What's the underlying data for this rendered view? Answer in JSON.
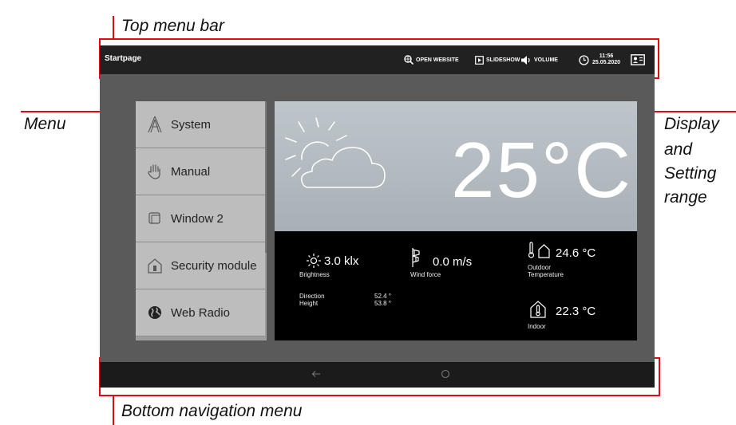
{
  "annotations": {
    "top_menu_bar": "Top menu bar",
    "menu": "Menu",
    "display_lines": [
      "Display",
      "and",
      "Setting",
      "range"
    ],
    "bottom_nav": "Bottom navigation menu"
  },
  "topbar": {
    "title": "Startpage",
    "open_website": "OPEN WEBSITE",
    "slideshow": "SLIDESHOW",
    "volume": "VOLUME",
    "time": "11:56",
    "date": "25.05.2020"
  },
  "menu": {
    "items": [
      {
        "label": "System",
        "icon": "system-icon"
      },
      {
        "label": "Manual",
        "icon": "hand-icon"
      },
      {
        "label": "Window 2",
        "icon": "window-icon"
      },
      {
        "label": "Security module",
        "icon": "security-house-icon"
      },
      {
        "label": "Web Radio",
        "icon": "globe-icon"
      }
    ]
  },
  "display": {
    "temperature": "25°C",
    "brightness_value": "3.0 klx",
    "brightness_label": "Brightness",
    "wind_value": "0.0 m/s",
    "wind_label": "Wind force",
    "outdoor_value": "24.6 °C",
    "outdoor_label_1": "Outdoor",
    "outdoor_label_2": "Temperature",
    "direction_label": "Direction",
    "direction_value": "52.4 °",
    "height_label": "Height",
    "height_value": "53.8 °",
    "indoor_value": "22.3 °C",
    "indoor_label": "Indoor"
  },
  "colors": {
    "annotation_red": "#e10b17",
    "bar_dark": "#212121",
    "menu_bg": "#bdbdbd"
  }
}
